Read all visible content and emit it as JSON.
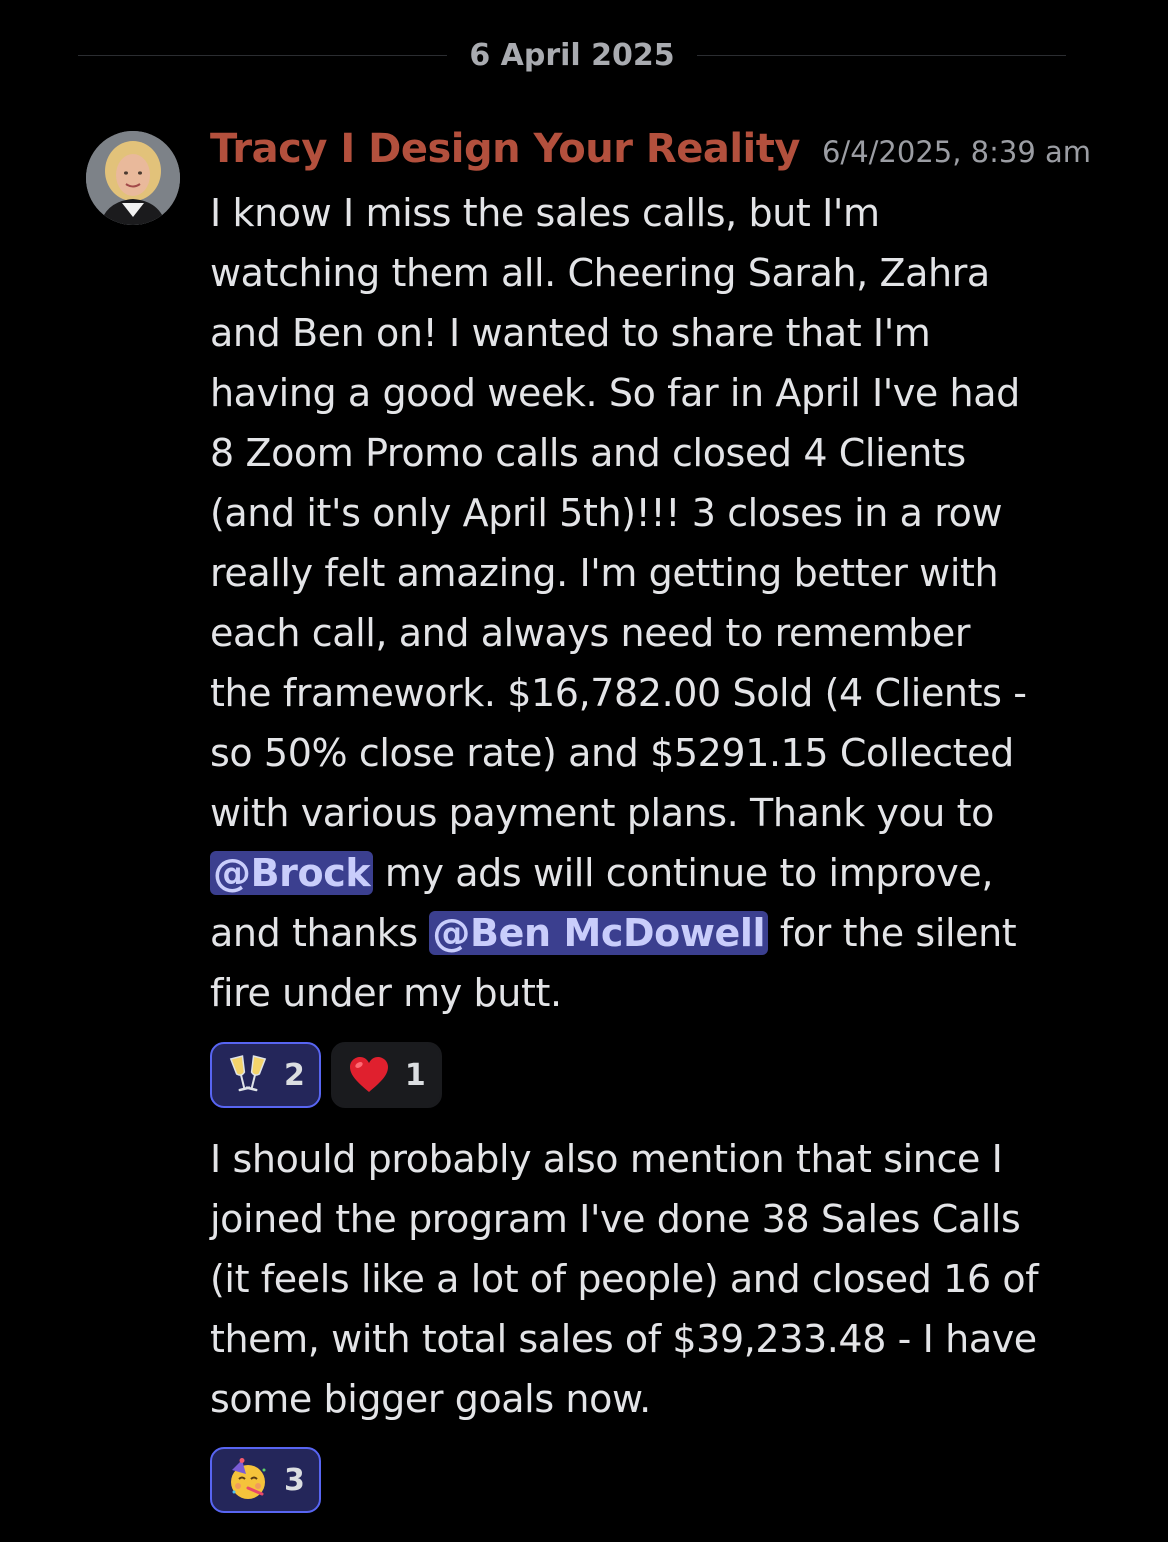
{
  "date_divider": "6 April 2025",
  "message": {
    "author": "Tracy I Design Your Reality",
    "timestamp": "6/4/2025, 8:39 am",
    "avatar_icon": "profile-photo",
    "paragraph1": {
      "line1": "I know I miss the sales calls, but I'm",
      "line2": "watching them all. Cheering Sarah, Zahra",
      "line3": "and Ben on! I wanted to share that I'm",
      "line4": "having a good week. So far in April I've had",
      "line5": "8 Zoom Promo calls and closed 4 Clients",
      "line6": "(and it's only April 5th)!!! 3 closes in a row",
      "line7": "really felt amazing. I'm getting better with",
      "line8": "each call, and always need to remember",
      "line9": "the framework. $16,782.00 Sold (4 Clients -",
      "line10": "so 50% close rate) and $5291.15 Collected",
      "line11": "with various payment plans. Thank you to",
      "mention1": "@Brock",
      "line12_rest": " my ads will continue to improve,",
      "line13_start": "and thanks ",
      "mention2": "@Ben McDowell",
      "line13_rest": " for the silent",
      "line14": "fire under my butt."
    },
    "reactions1": [
      {
        "icon": "clinking-glasses-icon",
        "count": "2",
        "reacted": true
      },
      {
        "icon": "red-heart-icon",
        "count": "1",
        "reacted": false
      }
    ],
    "paragraph2": {
      "line1": "I should probably also mention that since I",
      "line2": "joined the program I've done 38 Sales Calls",
      "line3": "(it feels like a lot of people) and closed 16 of",
      "line4": "them, with total sales of $39,233.48 - I have",
      "line5": "some bigger goals now."
    },
    "reactions2": [
      {
        "icon": "partying-face-icon",
        "count": "3",
        "reacted": true
      }
    ]
  },
  "colors": {
    "background": "#000000",
    "username": "#b3503d",
    "mention_bg": "#3b3f8f",
    "mention_text": "#c9cdfb",
    "reaction_active_border": "#5865f2"
  }
}
